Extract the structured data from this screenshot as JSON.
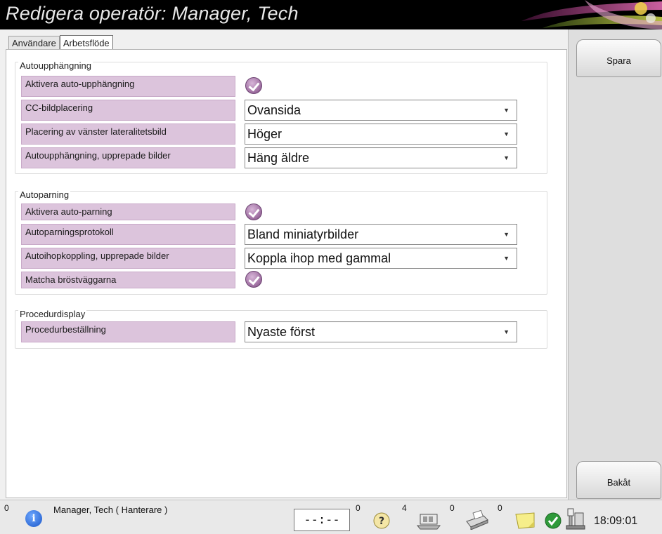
{
  "window": {
    "title": "Redigera operatör: Manager, Tech"
  },
  "tabs": [
    {
      "label": "Användare",
      "active": false
    },
    {
      "label": "Arbetsflöde",
      "active": true
    }
  ],
  "groups": {
    "autohanging": {
      "title": "Autoupphängning",
      "rows": [
        {
          "label": "Aktivera auto-upphängning",
          "type": "checkbox",
          "checked": true
        },
        {
          "label": "CC-bildplacering",
          "type": "select",
          "value": "Ovansida"
        },
        {
          "label": "Placering av vänster lateralitetsbild",
          "type": "select",
          "value": "Höger"
        },
        {
          "label": "Autoupphängning, upprepade bilder",
          "type": "select",
          "value": "Häng äldre"
        }
      ]
    },
    "autopairing": {
      "title": "Autoparning",
      "rows": [
        {
          "label": "Aktivera auto-parning",
          "type": "checkbox",
          "checked": true
        },
        {
          "label": "Autoparningsprotokoll",
          "type": "select",
          "value": "Bland miniatyrbilder"
        },
        {
          "label": "Autoihopkoppling, upprepade bilder",
          "type": "select",
          "value": "Koppla ihop med gammal"
        },
        {
          "label": "Matcha bröstväggarna",
          "type": "checkbox",
          "checked": true
        }
      ]
    },
    "procedure": {
      "title": "Procedurdisplay",
      "rows": [
        {
          "label": "Procedurbeställning",
          "type": "select",
          "value": "Nyaste först"
        }
      ]
    }
  },
  "sidebar": {
    "save_label": "Spara",
    "back_label": "Bakåt"
  },
  "statusbar": {
    "alerts_count": "0",
    "user": "Manager, Tech ( Hanterare )",
    "timer": "--:--",
    "help_count": "0",
    "queue_count": "4",
    "print_count": "0",
    "notes_count": "0",
    "clock": "18:09:01",
    "icons": [
      "info-icon",
      "help-icon",
      "image-queue-icon",
      "printer-icon",
      "notes-icon",
      "status-ok-icon",
      "system-icon"
    ]
  },
  "colors": {
    "label_bg": "#dcc4dc",
    "check_accent": "#a97bab",
    "title_bar": "#000000"
  }
}
